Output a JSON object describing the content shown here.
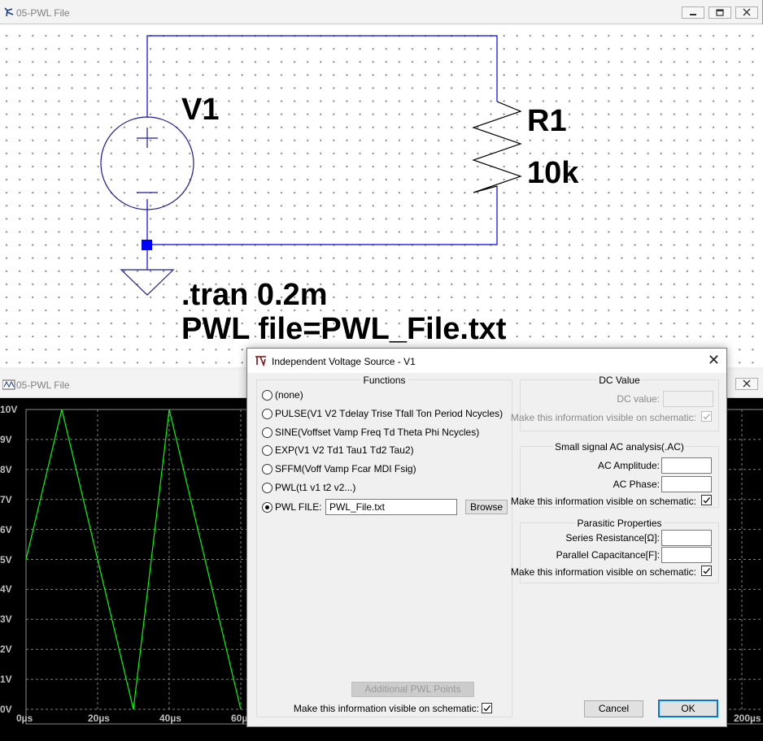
{
  "schematic_window": {
    "title": "05-PWL File",
    "v1_label": "V1",
    "r1_label": "R1",
    "r1_value": "10k",
    "directive_tran": ".tran 0.2m",
    "directive_pwl": "PWL file=PWL_File.txt",
    "wire_color": "#0000ff",
    "source_outline_color": "#1a1aa0"
  },
  "waveform_window": {
    "title": "05-PWL File",
    "trace_color": "#00ff00",
    "background": "#000000"
  },
  "chart_data": {
    "type": "line",
    "y_tick_labels": [
      "10V",
      "9V",
      "8V",
      "7V",
      "6V",
      "5V",
      "4V",
      "3V",
      "2V",
      "1V",
      "0V"
    ],
    "x_tick_labels": [
      "0µs",
      "20µs",
      "40µs",
      "60µ",
      "200µs"
    ],
    "xlim_us": [
      0,
      200
    ],
    "ylim": [
      0,
      10
    ],
    "grid": true,
    "series": [
      {
        "x": [
          0,
          10,
          30,
          40,
          60
        ],
        "y": [
          5,
          10,
          0,
          10,
          0
        ]
      }
    ]
  },
  "dialog": {
    "title": "Independent Voltage Source - V1",
    "close_glyph": "✕",
    "functions": {
      "label": "Functions",
      "options": [
        "(none)",
        "PULSE(V1 V2 Tdelay Trise Tfall Ton Period Ncycles)",
        "SINE(Voffset Vamp Freq Td Theta Phi Ncycles)",
        "EXP(V1 V2 Td1 Tau1 Td2 Tau2)",
        "SFFM(Voff Vamp Fcar MDI Fsig)",
        "PWL(t1 v1 t2 v2...)",
        "PWL FILE:"
      ],
      "selected_index": 6,
      "pwl_file_value": "PWL_File.txt",
      "browse_label": "Browse",
      "additional_pwl_label": "Additional PWL Points",
      "visible_label": "Make this information visible on schematic:",
      "visible_checked": true
    },
    "dc_value": {
      "label": "DC Value",
      "field_label": "DC value:",
      "value": "",
      "visible_label": "Make this information visible on schematic:",
      "visible_checked": true
    },
    "ac_analysis": {
      "label": "Small signal AC analysis(.AC)",
      "amplitude_label": "AC Amplitude:",
      "amplitude_value": "",
      "phase_label": "AC Phase:",
      "phase_value": "",
      "visible_label": "Make this information visible on schematic:",
      "visible_checked": true
    },
    "parasitic": {
      "label": "Parasitic Properties",
      "series_r_label": "Series Resistance[Ω]:",
      "series_r_value": "",
      "parallel_c_label": "Parallel Capacitance[F]:",
      "parallel_c_value": "",
      "visible_label": "Make this information visible on schematic:",
      "visible_checked": true
    },
    "cancel_label": "Cancel",
    "ok_label": "OK"
  }
}
